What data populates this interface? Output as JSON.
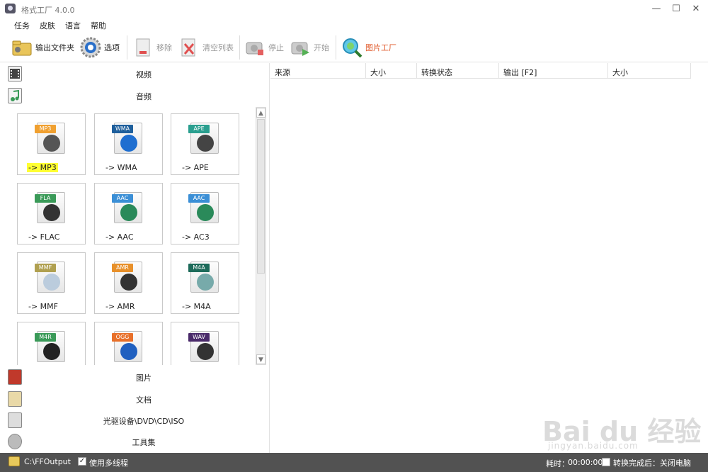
{
  "window": {
    "title": "格式工厂 4.0.0",
    "minimize": "—",
    "maximize": "☐",
    "close": "✕"
  },
  "menu": [
    "任务",
    "皮肤",
    "语言",
    "帮助"
  ],
  "toolbar": {
    "output_folder": "输出文件夹",
    "options": "选项",
    "remove": "移除",
    "clear_list": "清空列表",
    "stop": "停止",
    "start": "开始",
    "picture_factory": "图片工厂"
  },
  "categories": {
    "video": "视频",
    "audio": "音频",
    "picture": "图片",
    "document": "文档",
    "disc": "光驱设备\\DVD\\CD\\ISO",
    "tools": "工具集"
  },
  "audio_formats": [
    {
      "tag": "MP3",
      "label": "-> MP3",
      "tag_color": "#f0a030",
      "glyph_color": "#555",
      "highlighted": true
    },
    {
      "tag": "WMA",
      "label": "-> WMA",
      "tag_color": "#1e5f9c",
      "glyph_color": "#1e6ed0"
    },
    {
      "tag": "APE",
      "label": "-> APE",
      "tag_color": "#2a9f8f",
      "glyph_color": "#444"
    },
    {
      "tag": "FLA",
      "label": "-> FLAC",
      "tag_color": "#3a9a58",
      "glyph_color": "#333"
    },
    {
      "tag": "AAC",
      "label": "-> AAC",
      "tag_color": "#3b8fd6",
      "glyph_color": "#2a8a5a"
    },
    {
      "tag": "AAC",
      "label": "-> AC3",
      "tag_color": "#3b8fd6",
      "glyph_color": "#2a8a5a"
    },
    {
      "tag": "MMF",
      "label": "-> MMF",
      "tag_color": "#b0a050",
      "glyph_color": "#bcd"
    },
    {
      "tag": "AMR",
      "label": "-> AMR",
      "tag_color": "#e8902a",
      "glyph_color": "#333"
    },
    {
      "tag": "M4A",
      "label": "-> M4A",
      "tag_color": "#1d6b5a",
      "glyph_color": "#7aa"
    },
    {
      "tag": "M4R",
      "label": "",
      "tag_color": "#3a9a58",
      "glyph_color": "#222"
    },
    {
      "tag": "OGG",
      "label": "",
      "tag_color": "#e8702a",
      "glyph_color": "#2060c0"
    },
    {
      "tag": "WAV",
      "label": "",
      "tag_color": "#4a2a6a",
      "glyph_color": "#333"
    }
  ],
  "task_columns": [
    "来源",
    "大小",
    "转换状态",
    "输出 [F2]",
    "大小"
  ],
  "status": {
    "output_path": "C:\\FFOutput",
    "multithread_label": "使用多线程",
    "multithread_checked": true,
    "time_label": "耗时：",
    "time_value": "00:00:00",
    "after_done_label": "转换完成后：关闭电脑",
    "after_done_checked": false
  },
  "watermark": {
    "text": "Bai du 经验",
    "url": "jingyan.baidu.com"
  }
}
